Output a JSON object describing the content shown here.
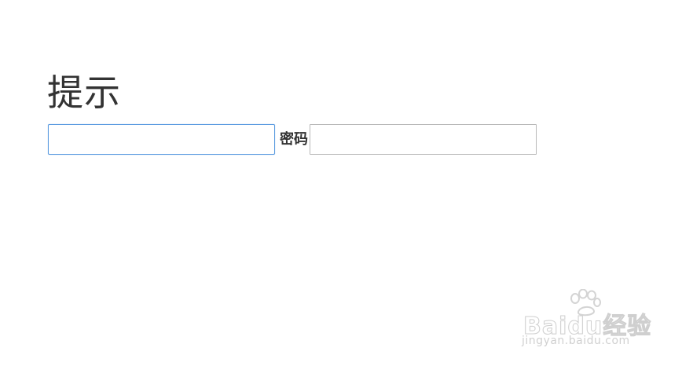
{
  "page": {
    "title": "提示"
  },
  "form": {
    "username": {
      "value": "",
      "focused": true
    },
    "password": {
      "label": "密码",
      "value": ""
    }
  },
  "watermark": {
    "brand": "Baidu经验",
    "url": "jingyan.baidu.com",
    "icon": "paw-icon"
  },
  "colors": {
    "text": "#333333",
    "focus_border": "#5b9be0",
    "input_border": "#b8b8b8",
    "watermark": "#d0d0d0"
  }
}
